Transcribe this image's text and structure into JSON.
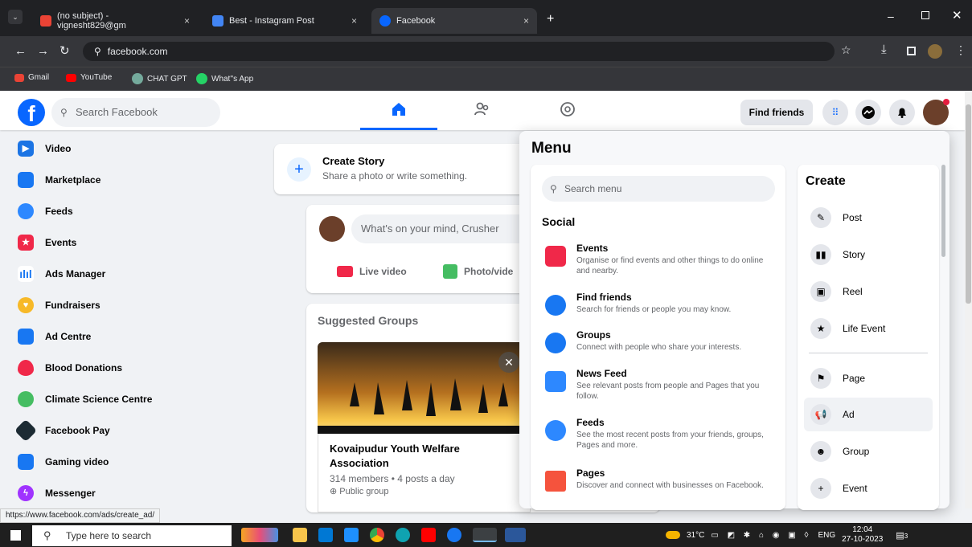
{
  "browser": {
    "tabs": [
      {
        "title": "(no subject) - vignesht829@gm",
        "color": "#ea4335"
      },
      {
        "title": "Best - Instagram Post",
        "color": "#4285f4"
      },
      {
        "title": "Facebook",
        "color": "#0866ff"
      }
    ],
    "close": "×",
    "new_tab": "+",
    "url": "facebook.com",
    "bookmarks": [
      "Gmail",
      "YouTube",
      "CHAT GPT",
      "What''s App"
    ],
    "status_url": "https://www.facebook.com/ads/create_ad/"
  },
  "fb": {
    "search_placeholder": "Search Facebook",
    "find_friends": "Find friends",
    "left_nav": [
      {
        "label": "Video",
        "color": "#1b74e4"
      },
      {
        "label": "Marketplace",
        "color": "#1877f2"
      },
      {
        "label": "Feeds",
        "color": "#2d88ff"
      },
      {
        "label": "Events",
        "color": "#f02849"
      },
      {
        "label": "Ads Manager",
        "color": "#1877f2"
      },
      {
        "label": "Fundraisers",
        "color": "#f7b928"
      },
      {
        "label": "Ad Centre",
        "color": "#1877f2"
      },
      {
        "label": "Blood Donations",
        "color": "#f02849"
      },
      {
        "label": "Climate Science Centre",
        "color": "#45bd62"
      },
      {
        "label": "Facebook Pay",
        "color": "#1c2b33"
      },
      {
        "label": "Gaming video",
        "color": "#1877f2"
      },
      {
        "label": "Messenger",
        "color": "#a033ff"
      }
    ],
    "create_story": {
      "title": "Create Story",
      "subtitle": "Share a photo or write something."
    },
    "composer": {
      "placeholder": "What's on your mind, Crusher",
      "live": "Live video",
      "photo": "Photo/vide"
    },
    "suggested": {
      "title": "Suggested Groups",
      "group_name": "Kovaipudur Youth Welfare Association",
      "meta": "314 members • 4 posts a day",
      "privacy": "Public group"
    }
  },
  "menu": {
    "title": "Menu",
    "search_placeholder": "Search menu",
    "social_heading": "Social",
    "items": [
      {
        "title": "Events",
        "desc": "Organise or find events and other things to do online and nearby."
      },
      {
        "title": "Find friends",
        "desc": "Search for friends or people you may know."
      },
      {
        "title": "Groups",
        "desc": "Connect with people who share your interests."
      },
      {
        "title": "News Feed",
        "desc": "See relevant posts from people and Pages that you follow."
      },
      {
        "title": "Feeds",
        "desc": "See the most recent posts from your friends, groups, Pages and more."
      },
      {
        "title": "Pages",
        "desc": "Discover and connect with businesses on Facebook."
      }
    ],
    "create_heading": "Create",
    "create": [
      "Post",
      "Story",
      "Reel",
      "Life Event",
      "Page",
      "Ad",
      "Group",
      "Event"
    ]
  },
  "taskbar": {
    "search": "Type here to search",
    "temp": "31°C",
    "lang": "ENG",
    "time": "12:04",
    "date": "27-10-2023",
    "notif": "3"
  }
}
